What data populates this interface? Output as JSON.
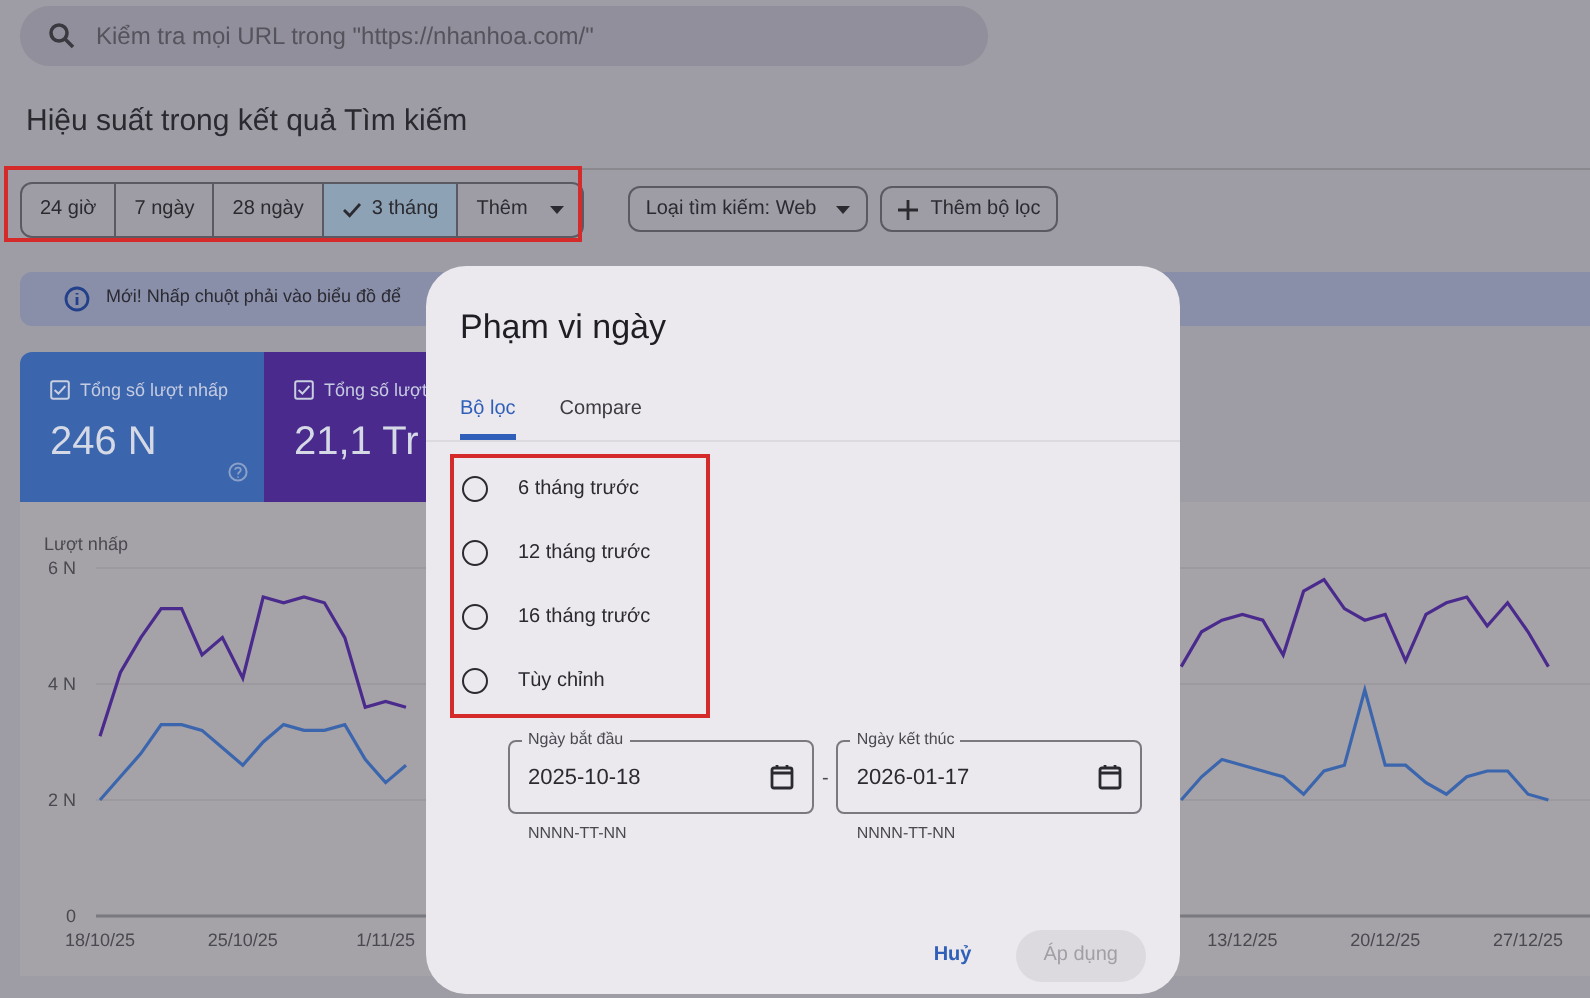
{
  "search": {
    "placeholder": "Kiểm tra mọi URL trong \"https://nhanhoa.com/\""
  },
  "title": "Hiệu suất trong kết quả Tìm kiếm",
  "date_chips": [
    {
      "kind": "preset",
      "label": "24 giờ",
      "selected": false
    },
    {
      "kind": "preset",
      "label": "7 ngày",
      "selected": false
    },
    {
      "kind": "preset",
      "label": "28 ngày",
      "selected": false
    },
    {
      "kind": "preset",
      "label": "3 tháng",
      "selected": true
    },
    {
      "kind": "menu",
      "label": "Thêm",
      "selected": false
    }
  ],
  "filters": [
    {
      "kind": "dropdown",
      "label": "Loại tìm kiếm: Web"
    },
    {
      "kind": "add",
      "label": "Thêm bộ lọc"
    }
  ],
  "notice": {
    "text": "Mới! Nhấp chuột phải vào biểu đồ để"
  },
  "metrics": [
    {
      "label": "Tổng số lượt nhấp",
      "value": "246 N",
      "color": "#3b66ad",
      "help": true
    },
    {
      "label": "Tổng số lượt",
      "value": "21,1 Tr",
      "color": "#4a2a8c",
      "help": false
    }
  ],
  "chart": {
    "chart_data": {
      "type": "line",
      "ylabel": "Lượt nhấp",
      "categories": [
        "18/10/25",
        null,
        null,
        null,
        null,
        null,
        null,
        "25/10/25",
        null,
        null,
        null,
        null,
        null,
        null,
        "1/11/25",
        null,
        null,
        null,
        null,
        null,
        null,
        null,
        null,
        null,
        null,
        null,
        null,
        null,
        null,
        null,
        null,
        null,
        null,
        null,
        null,
        null,
        null,
        null,
        null,
        null,
        null,
        null,
        null,
        null,
        null,
        null,
        null,
        null,
        null,
        null,
        null,
        null,
        null,
        null,
        null,
        null,
        "13/12/25",
        null,
        null,
        null,
        null,
        null,
        null,
        "20/12/25",
        null,
        null,
        null,
        null,
        null,
        null,
        "27/12/25",
        null
      ],
      "series": [
        {
          "color": "#4a2a8c",
          "values": [
            3.1,
            4.2,
            4.8,
            5.3,
            5.3,
            4.5,
            4.8,
            4.1,
            5.5,
            5.4,
            5.5,
            5.4,
            4.8,
            3.6,
            3.7,
            3.6,
            null,
            null,
            null,
            null,
            null,
            null,
            null,
            null,
            null,
            null,
            null,
            null,
            null,
            null,
            null,
            null,
            null,
            null,
            null,
            null,
            null,
            null,
            null,
            null,
            null,
            null,
            null,
            null,
            null,
            null,
            null,
            null,
            null,
            null,
            null,
            null,
            null,
            4.3,
            4.9,
            5.1,
            5.2,
            5.1,
            4.5,
            5.6,
            5.8,
            5.3,
            5.1,
            5.2,
            4.4,
            5.2,
            5.4,
            5.5,
            5.0,
            5.4,
            4.9,
            4.3
          ]
        },
        {
          "color": "#3b66ad",
          "values": [
            2.0,
            2.4,
            2.8,
            3.3,
            3.3,
            3.2,
            2.9,
            2.6,
            3.0,
            3.3,
            3.2,
            3.2,
            3.3,
            2.7,
            2.3,
            2.6,
            null,
            null,
            null,
            null,
            null,
            null,
            null,
            null,
            null,
            null,
            null,
            null,
            null,
            null,
            null,
            null,
            null,
            null,
            null,
            null,
            null,
            null,
            null,
            null,
            null,
            null,
            null,
            null,
            null,
            null,
            null,
            null,
            null,
            null,
            null,
            null,
            null,
            2.0,
            2.4,
            2.7,
            2.6,
            2.5,
            2.4,
            2.1,
            2.5,
            2.6,
            3.9,
            2.6,
            2.6,
            2.3,
            2.1,
            2.4,
            2.5,
            2.5,
            2.1,
            2.0
          ]
        }
      ],
      "ylim": [
        0,
        6
      ],
      "yticks": [
        {
          "value": 0,
          "label": "0"
        },
        {
          "value": 2,
          "label": "2 N"
        },
        {
          "value": 4,
          "label": "4 N"
        },
        {
          "value": 6,
          "label": "6 N"
        }
      ]
    }
  },
  "dialog": {
    "title": "Phạm vi ngày",
    "tabs": [
      {
        "label": "Bộ lọc",
        "selected": true
      },
      {
        "label": "Compare",
        "selected": false
      }
    ],
    "options": [
      {
        "label": "6 tháng trước",
        "selected": false
      },
      {
        "label": "12 tháng trước",
        "selected": false
      },
      {
        "label": "16 tháng trước",
        "selected": false
      },
      {
        "label": "Tùy chỉnh",
        "selected": false
      }
    ],
    "date_separator": "-",
    "date_fields": [
      {
        "label": "Ngày bắt đầu",
        "value": "2025-10-18",
        "hint": "NNNN-TT-NN"
      },
      {
        "label": "Ngày kết thúc",
        "value": "2026-01-17",
        "hint": "NNNN-TT-NN"
      }
    ],
    "buttons": [
      {
        "label": "Huỷ",
        "disabled": false
      },
      {
        "label": "Áp dụng",
        "disabled": true
      }
    ]
  }
}
